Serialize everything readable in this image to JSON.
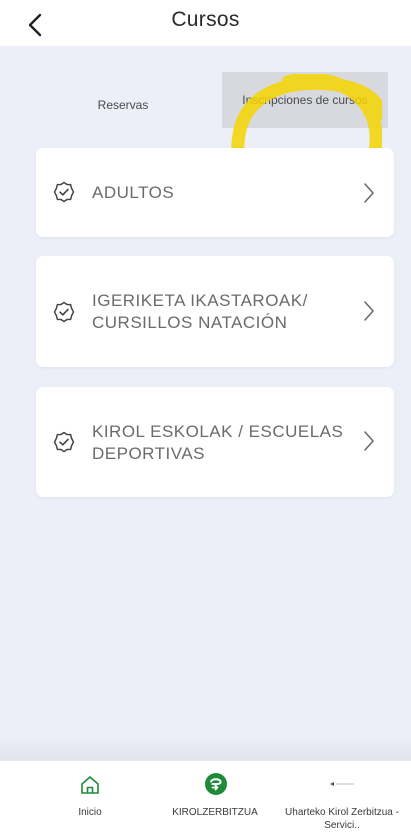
{
  "header": {
    "title": "Cursos"
  },
  "tabs": [
    {
      "label": "Reservas"
    },
    {
      "label": "Inscripciones de cursos"
    }
  ],
  "courses": [
    {
      "label": "ADULTOS"
    },
    {
      "label": "IGERIKETA IKASTAROAK/ CURSILLOS NATACIÓN"
    },
    {
      "label": "KIROL ESKOLAK / ESCUELAS DEPORTIVAS"
    }
  ],
  "bottom_nav": [
    {
      "label": "Inicio",
      "icon": "home-icon"
    },
    {
      "label": "KIROLZERBITZUA",
      "icon": "kirolzerbitzua-logo-icon"
    },
    {
      "label": "Uharteko Kirol Zerbitzua - Servici..",
      "icon": "uharte-logo-icon"
    }
  ],
  "colors": {
    "background": "#eceef8",
    "highlight": "#f5d400",
    "active_tab": "#d7d9df",
    "brand_green": "#1f8a3a"
  }
}
